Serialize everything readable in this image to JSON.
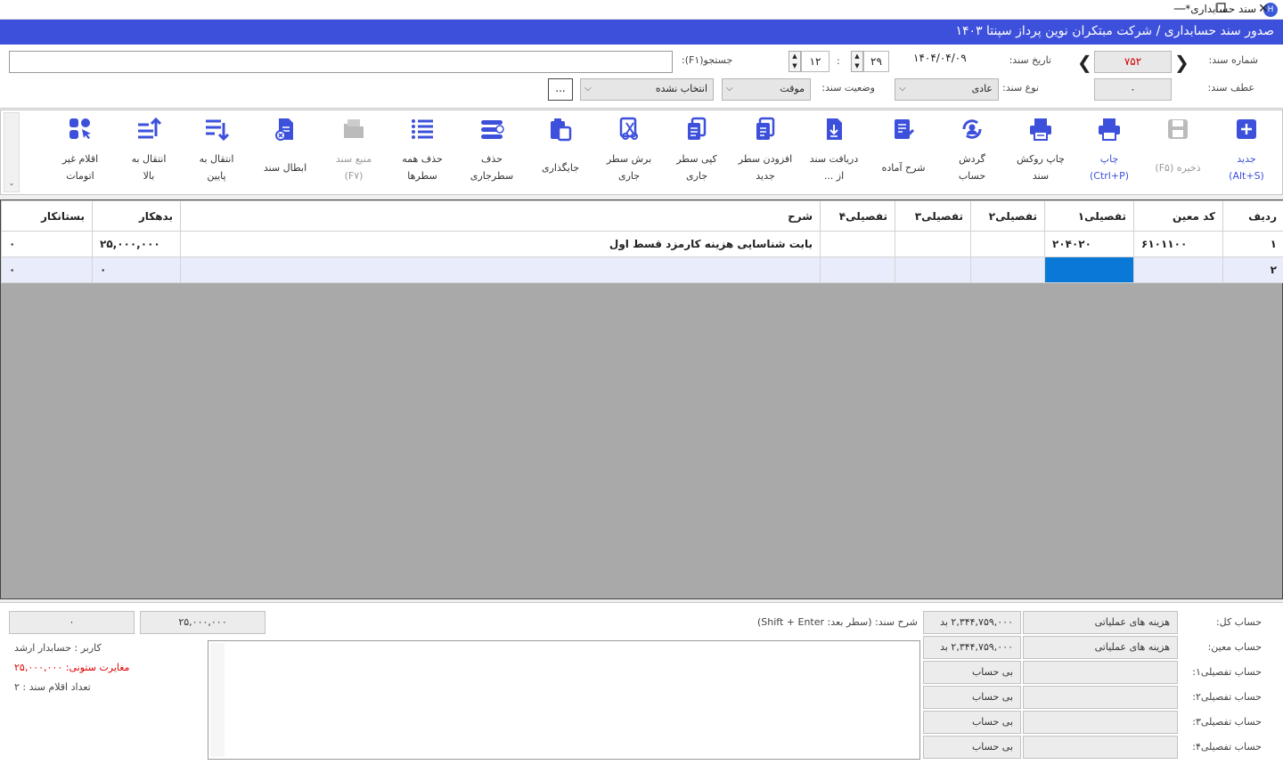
{
  "window": {
    "title": "سند حسابداری*",
    "minimize": "—",
    "restore": "❐",
    "close": "✕"
  },
  "header": {
    "title": "صدور سند حسابداری / شرکت مبتکران نوین پرداز سپنتا ۱۴۰۳"
  },
  "form": {
    "doc_number_label": "شماره سند:",
    "doc_number": "۷۵۲",
    "ref_label": "عطف سند:",
    "ref_value": "۰",
    "date_label": "تاریخ سند:",
    "date_value": "۱۴۰۴/۰۴/۰۹",
    "type_label": "نوع سند:",
    "type_value": "عادی",
    "hour": "۲۹",
    "minute": "۱۲",
    "colon": ":",
    "status_label": "وضعیت سند:",
    "status_value": "موقت",
    "not_selected": "انتخاب نشده",
    "search_label": "جستجو(F۱):",
    "search_value": "",
    "ellipsis": "..."
  },
  "toolbar": [
    {
      "l1": "جدید",
      "l2": "(Alt+S)",
      "icon": "plus-icon"
    },
    {
      "l1": "ذخیره (F۵)",
      "l2": "",
      "icon": "save-icon"
    },
    {
      "l1": "چاپ",
      "l2": "(Ctrl+P)",
      "icon": "print-icon"
    },
    {
      "l1": "چاپ روکش",
      "l2": "سند",
      "icon": "print-cover-icon"
    },
    {
      "l1": "گردش",
      "l2": "حساب",
      "icon": "account-cycle-icon"
    },
    {
      "l1": "شرح آماده",
      "l2": "",
      "icon": "edit-note-icon"
    },
    {
      "l1": "دریافت سند",
      "l2": "از ...",
      "icon": "download-doc-icon"
    },
    {
      "l1": "افزودن سطر",
      "l2": "جدید",
      "icon": "add-row-icon"
    },
    {
      "l1": "کپی سطر",
      "l2": "جاری",
      "icon": "copy-icon"
    },
    {
      "l1": "برش سطر",
      "l2": "جاری",
      "icon": "cut-icon"
    },
    {
      "l1": "جایگذاری",
      "l2": "",
      "icon": "paste-icon"
    },
    {
      "l1": "حذف",
      "l2": "سطرجاری",
      "icon": "delete-row-icon"
    },
    {
      "l1": "حذف همه",
      "l2": "سطرها",
      "icon": "delete-all-icon"
    },
    {
      "l1": "منبع سند",
      "l2": "(F۷)",
      "icon": "source-folder-icon"
    },
    {
      "l1": "ابطال سند",
      "l2": "",
      "icon": "cancel-doc-icon"
    },
    {
      "l1": "انتقال به",
      "l2": "پایین",
      "icon": "move-down-icon"
    },
    {
      "l1": "انتقال به",
      "l2": "بالا",
      "icon": "move-up-icon"
    },
    {
      "l1": "اقلام غیر",
      "l2": "اتومات",
      "icon": "non-auto-items-icon"
    }
  ],
  "grid": {
    "columns": [
      "ردیف",
      "کد معین",
      "تفصیلی۱",
      "تفصیلی۲",
      "تفصیلی۳",
      "تفصیلی۴",
      "شرح",
      "بدهکار",
      "بستانکار"
    ],
    "rows": [
      [
        "۱",
        "۶۱۰۱۱۰۰",
        "۲۰۴۰۲۰",
        "",
        "",
        "",
        "بابت شناسایی هزینه کارمزد قسط اول",
        "۲۵,۰۰۰,۰۰۰",
        "۰"
      ],
      [
        "۲",
        "",
        "",
        "",
        "",
        "",
        "",
        "۰",
        "۰"
      ]
    ]
  },
  "footer": {
    "total_label": "حساب کل:",
    "moein_label": "حساب معین:",
    "t1_label": "حساب تفصیلی۱:",
    "t2_label": "حساب تفصیلی۲:",
    "t3_label": "حساب تفصیلی۳:",
    "t4_label": "حساب تفصیلی۴:",
    "total_value": "هزینه های عملیاتی",
    "moein_value": "هزینه های عملیاتی",
    "total_amount": "۲,۳۴۴,۷۵۹,۰۰۰ بد",
    "moein_amount": "۲,۳۴۴,۷۵۹,۰۰۰ بد",
    "no_account": "بی حساب",
    "memo_label": "شرح سند: (سطر بعد: Shift + Enter)",
    "sum_debit": "۲۵,۰۰۰,۰۰۰",
    "sum_credit": "۰",
    "user": "کاربر : حسابدار ارشد",
    "mismatch": "مغایرت ستونی: ۲۵,۰۰۰,۰۰۰",
    "item_count": "تعداد اقلام سند : ۲"
  },
  "colors": {
    "header": "#3d50db",
    "accent": "#3d50db",
    "selected_cell": "#0a78d7",
    "doc_number": "#d00000",
    "error": "#e00000"
  }
}
